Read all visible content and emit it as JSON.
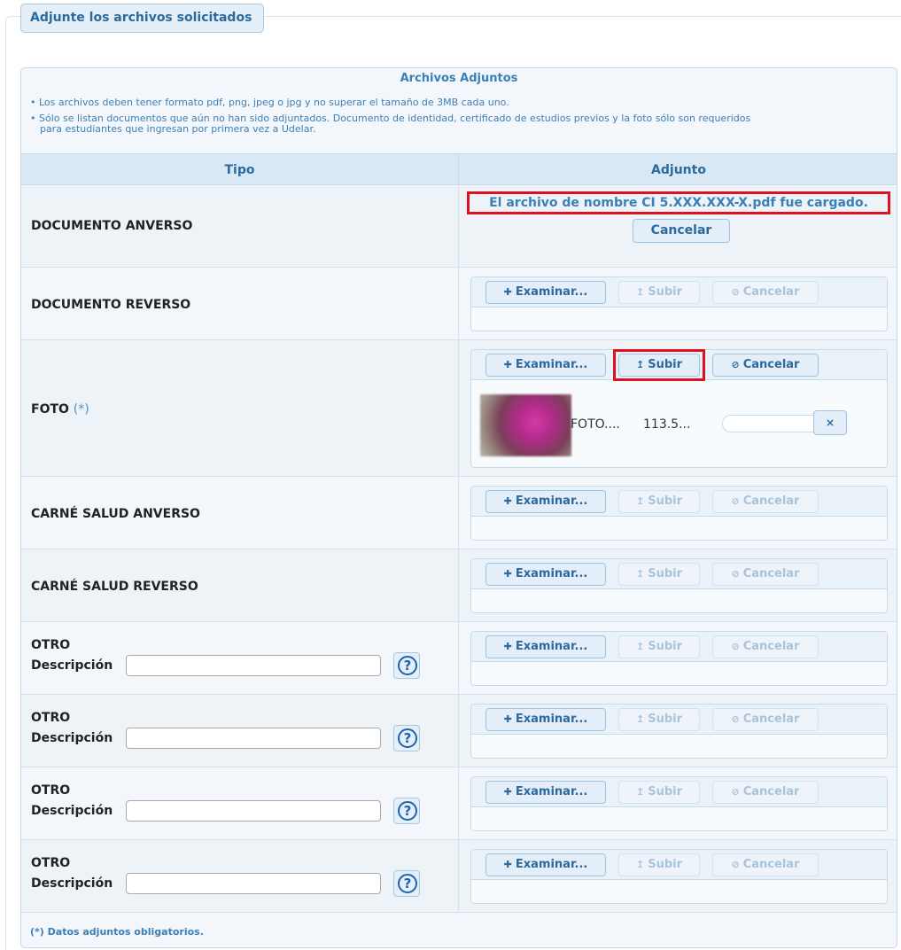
{
  "legend": "Adjunte los archivos solicitados",
  "panel": {
    "title": "Archivos Adjuntos",
    "note1": "• Los archivos deben tener formato pdf, png, jpeg o jpg y no superar el tamaño de 3MB cada uno.",
    "note2a": "• Sólo se listan documentos que aún no han sido adjuntados. Documento de identidad, certificado de estudios previos y la foto sólo son requeridos",
    "note2b": "para estudiantes que ingresan por primera vez a Udelar."
  },
  "columns": {
    "tipo": "Tipo",
    "adjunto": "Adjunto"
  },
  "buttons": {
    "examinar": "Examinar...",
    "subir": "Subir",
    "cancelar": "Cancelar",
    "cancelar_big": "Cancelar",
    "remove": "×"
  },
  "icons": {
    "add": "plus-icon",
    "upload": "upload-icon",
    "cancel": "cancel-icon",
    "help": "help-icon"
  },
  "rows": [
    {
      "label": "DOCUMENTO ANVERSO",
      "loaded_message": "El archivo de nombre CI 5.XXX.XXX-X.pdf fue cargado."
    },
    {
      "label": "DOCUMENTO REVERSO"
    },
    {
      "label": "FOTO",
      "required_mark": "(*)",
      "file_name": "FOTO....",
      "file_size": "113.5..."
    },
    {
      "label": "CARNÉ SALUD ANVERSO"
    },
    {
      "label": "CARNÉ SALUD REVERSO"
    },
    {
      "label": "OTRO",
      "desc_label": "Descripción",
      "desc_value": ""
    },
    {
      "label": "OTRO",
      "desc_label": "Descripción",
      "desc_value": ""
    },
    {
      "label": "OTRO",
      "desc_label": "Descripción",
      "desc_value": ""
    },
    {
      "label": "OTRO",
      "desc_label": "Descripción",
      "desc_value": ""
    }
  ],
  "footer_note": "(*) Datos adjuntos obligatorios.",
  "colors": {
    "accent": "#3b7fb6",
    "highlight": "#e01020"
  }
}
